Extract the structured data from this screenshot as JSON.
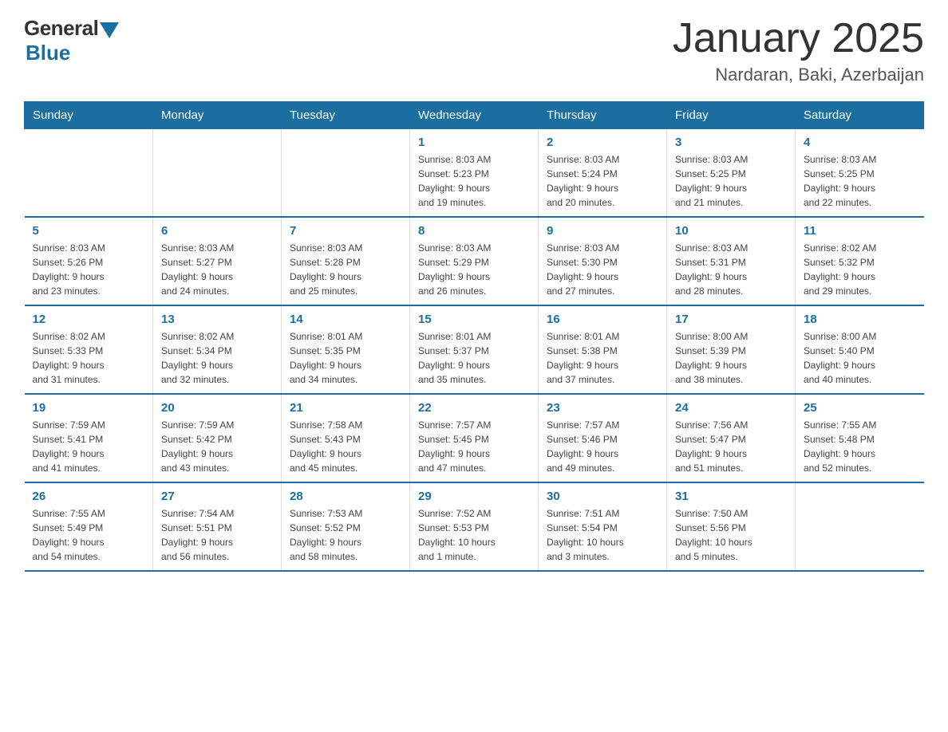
{
  "logo": {
    "general": "General",
    "blue": "Blue"
  },
  "title": "January 2025",
  "location": "Nardaran, Baki, Azerbaijan",
  "days_of_week": [
    "Sunday",
    "Monday",
    "Tuesday",
    "Wednesday",
    "Thursday",
    "Friday",
    "Saturday"
  ],
  "weeks": [
    [
      {
        "num": "",
        "info": ""
      },
      {
        "num": "",
        "info": ""
      },
      {
        "num": "",
        "info": ""
      },
      {
        "num": "1",
        "info": "Sunrise: 8:03 AM\nSunset: 5:23 PM\nDaylight: 9 hours\nand 19 minutes."
      },
      {
        "num": "2",
        "info": "Sunrise: 8:03 AM\nSunset: 5:24 PM\nDaylight: 9 hours\nand 20 minutes."
      },
      {
        "num": "3",
        "info": "Sunrise: 8:03 AM\nSunset: 5:25 PM\nDaylight: 9 hours\nand 21 minutes."
      },
      {
        "num": "4",
        "info": "Sunrise: 8:03 AM\nSunset: 5:25 PM\nDaylight: 9 hours\nand 22 minutes."
      }
    ],
    [
      {
        "num": "5",
        "info": "Sunrise: 8:03 AM\nSunset: 5:26 PM\nDaylight: 9 hours\nand 23 minutes."
      },
      {
        "num": "6",
        "info": "Sunrise: 8:03 AM\nSunset: 5:27 PM\nDaylight: 9 hours\nand 24 minutes."
      },
      {
        "num": "7",
        "info": "Sunrise: 8:03 AM\nSunset: 5:28 PM\nDaylight: 9 hours\nand 25 minutes."
      },
      {
        "num": "8",
        "info": "Sunrise: 8:03 AM\nSunset: 5:29 PM\nDaylight: 9 hours\nand 26 minutes."
      },
      {
        "num": "9",
        "info": "Sunrise: 8:03 AM\nSunset: 5:30 PM\nDaylight: 9 hours\nand 27 minutes."
      },
      {
        "num": "10",
        "info": "Sunrise: 8:03 AM\nSunset: 5:31 PM\nDaylight: 9 hours\nand 28 minutes."
      },
      {
        "num": "11",
        "info": "Sunrise: 8:02 AM\nSunset: 5:32 PM\nDaylight: 9 hours\nand 29 minutes."
      }
    ],
    [
      {
        "num": "12",
        "info": "Sunrise: 8:02 AM\nSunset: 5:33 PM\nDaylight: 9 hours\nand 31 minutes."
      },
      {
        "num": "13",
        "info": "Sunrise: 8:02 AM\nSunset: 5:34 PM\nDaylight: 9 hours\nand 32 minutes."
      },
      {
        "num": "14",
        "info": "Sunrise: 8:01 AM\nSunset: 5:35 PM\nDaylight: 9 hours\nand 34 minutes."
      },
      {
        "num": "15",
        "info": "Sunrise: 8:01 AM\nSunset: 5:37 PM\nDaylight: 9 hours\nand 35 minutes."
      },
      {
        "num": "16",
        "info": "Sunrise: 8:01 AM\nSunset: 5:38 PM\nDaylight: 9 hours\nand 37 minutes."
      },
      {
        "num": "17",
        "info": "Sunrise: 8:00 AM\nSunset: 5:39 PM\nDaylight: 9 hours\nand 38 minutes."
      },
      {
        "num": "18",
        "info": "Sunrise: 8:00 AM\nSunset: 5:40 PM\nDaylight: 9 hours\nand 40 minutes."
      }
    ],
    [
      {
        "num": "19",
        "info": "Sunrise: 7:59 AM\nSunset: 5:41 PM\nDaylight: 9 hours\nand 41 minutes."
      },
      {
        "num": "20",
        "info": "Sunrise: 7:59 AM\nSunset: 5:42 PM\nDaylight: 9 hours\nand 43 minutes."
      },
      {
        "num": "21",
        "info": "Sunrise: 7:58 AM\nSunset: 5:43 PM\nDaylight: 9 hours\nand 45 minutes."
      },
      {
        "num": "22",
        "info": "Sunrise: 7:57 AM\nSunset: 5:45 PM\nDaylight: 9 hours\nand 47 minutes."
      },
      {
        "num": "23",
        "info": "Sunrise: 7:57 AM\nSunset: 5:46 PM\nDaylight: 9 hours\nand 49 minutes."
      },
      {
        "num": "24",
        "info": "Sunrise: 7:56 AM\nSunset: 5:47 PM\nDaylight: 9 hours\nand 51 minutes."
      },
      {
        "num": "25",
        "info": "Sunrise: 7:55 AM\nSunset: 5:48 PM\nDaylight: 9 hours\nand 52 minutes."
      }
    ],
    [
      {
        "num": "26",
        "info": "Sunrise: 7:55 AM\nSunset: 5:49 PM\nDaylight: 9 hours\nand 54 minutes."
      },
      {
        "num": "27",
        "info": "Sunrise: 7:54 AM\nSunset: 5:51 PM\nDaylight: 9 hours\nand 56 minutes."
      },
      {
        "num": "28",
        "info": "Sunrise: 7:53 AM\nSunset: 5:52 PM\nDaylight: 9 hours\nand 58 minutes."
      },
      {
        "num": "29",
        "info": "Sunrise: 7:52 AM\nSunset: 5:53 PM\nDaylight: 10 hours\nand 1 minute."
      },
      {
        "num": "30",
        "info": "Sunrise: 7:51 AM\nSunset: 5:54 PM\nDaylight: 10 hours\nand 3 minutes."
      },
      {
        "num": "31",
        "info": "Sunrise: 7:50 AM\nSunset: 5:56 PM\nDaylight: 10 hours\nand 5 minutes."
      },
      {
        "num": "",
        "info": ""
      }
    ]
  ]
}
